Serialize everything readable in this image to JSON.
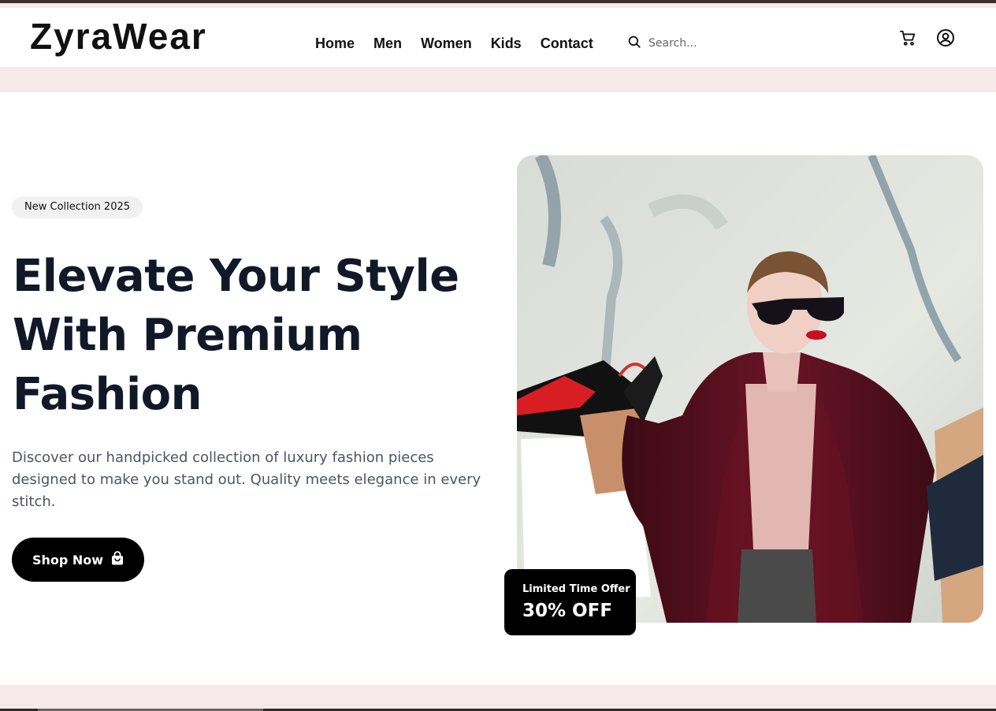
{
  "header": {
    "logo": "ZyraWear",
    "nav": [
      {
        "label": "Home"
      },
      {
        "label": "Men"
      },
      {
        "label": "Women"
      },
      {
        "label": "Kids"
      },
      {
        "label": "Contact"
      }
    ],
    "search": {
      "placeholder": "Search...",
      "icon": "search-icon"
    },
    "icons": [
      "cart-icon",
      "user-account-icon"
    ]
  },
  "hero": {
    "badge": "New Collection 2025",
    "headline": "Elevate Your Style With Premium Fashion",
    "description": "Discover our handpicked collection of luxury fashion pieces designed to make you stand out. Quality meets elegance in every stitch.",
    "cta": {
      "label": "Shop Now",
      "icon": "shopping-bag-icon"
    },
    "offer": {
      "label": "Limited Time Offer",
      "value": "30% OFF"
    }
  },
  "colors": {
    "accent_band": "#f6e9e9",
    "text_dark": "#111827",
    "text_muted": "#4b5563",
    "button": "#000000"
  }
}
